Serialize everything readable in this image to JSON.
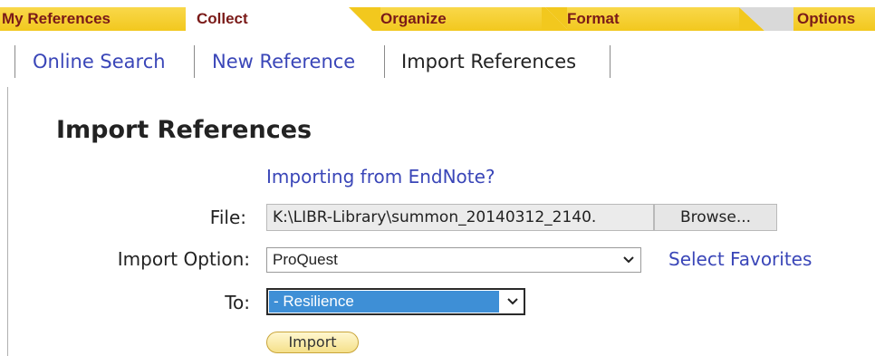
{
  "tabs": [
    {
      "label": "My References",
      "state": "inactive"
    },
    {
      "label": "Collect",
      "state": "active"
    },
    {
      "label": "Organize",
      "state": "inactive"
    },
    {
      "label": "Format",
      "state": "inactive"
    },
    {
      "label": "Options",
      "state": "inactive"
    }
  ],
  "subnav": {
    "items": [
      {
        "label": "Online Search",
        "current": false
      },
      {
        "label": "New Reference",
        "current": false
      },
      {
        "label": "Import References",
        "current": true
      }
    ]
  },
  "form": {
    "heading": "Import References",
    "endnote_link": "Importing from EndNote?",
    "file_label": "File:",
    "file_value": "K:\\LIBR-Library\\summon_20140312_2140.",
    "browse_label": "Browse...",
    "import_option_label": "Import Option:",
    "import_option_value": "ProQuest",
    "select_favorites": "Select Favorites",
    "to_label": "To:",
    "to_value": "- Resilience",
    "import_button": "Import"
  },
  "colors": {
    "tab_yellow": "#f2c81e",
    "tab_text": "#7a1a18",
    "link_blue": "#3a46b8",
    "selection_blue": "#3e8fd6"
  }
}
